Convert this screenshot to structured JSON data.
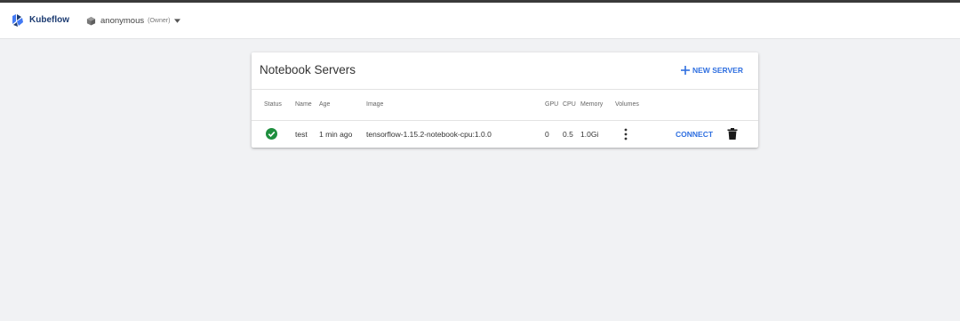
{
  "topbar": {
    "brand": "Kubeflow",
    "namespace": {
      "user": "anonymous",
      "role": "(Owner)"
    }
  },
  "card": {
    "title": "Notebook Servers",
    "new_server_label": "NEW SERVER",
    "columns": [
      "Status",
      "Name",
      "Age",
      "Image",
      "GPU",
      "CPU",
      "Memory",
      "Volumes"
    ],
    "rows": [
      {
        "status": "running",
        "name": "test",
        "age": "1 min ago",
        "image": "tensorflow-1.15.2-notebook-cpu:1.0.0",
        "gpu": "0",
        "cpu": "0.5",
        "memory": "1.0Gi",
        "connect_label": "CONNECT"
      }
    ]
  },
  "colors": {
    "accent": "#2f6fe0",
    "status_ok": "#1e8e3e",
    "brand": "#1d3c72"
  }
}
